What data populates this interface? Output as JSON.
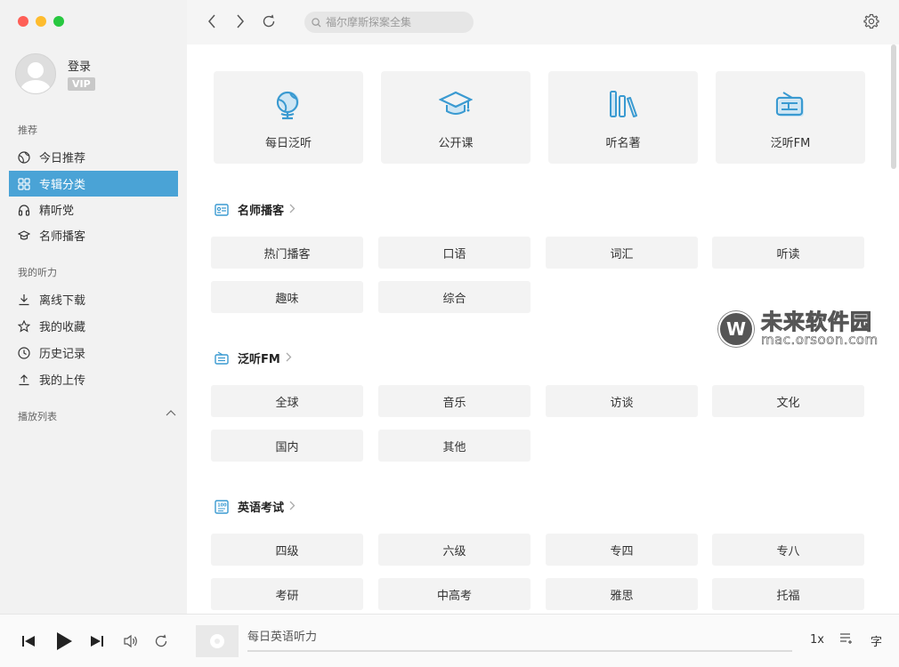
{
  "sidebar": {
    "user": {
      "login": "登录",
      "vip": "VIP"
    },
    "sections": {
      "recommend": "推荐",
      "my_listening": "我的听力",
      "playlist": "播放列表"
    },
    "recommend_items": [
      {
        "label": "今日推荐",
        "icon": "globe-icon"
      },
      {
        "label": "专辑分类",
        "icon": "grid-icon",
        "active": true
      },
      {
        "label": "精听党",
        "icon": "headphones-icon"
      },
      {
        "label": "名师播客",
        "icon": "graduation-cap-icon"
      }
    ],
    "listening_items": [
      {
        "label": "离线下载",
        "icon": "download-icon"
      },
      {
        "label": "我的收藏",
        "icon": "star-icon"
      },
      {
        "label": "历史记录",
        "icon": "clock-icon"
      },
      {
        "label": "我的上传",
        "icon": "upload-icon"
      }
    ]
  },
  "topbar": {
    "search_placeholder": "福尔摩斯探案全集"
  },
  "features": [
    {
      "label": "每日泛听",
      "icon": "globe-icon"
    },
    {
      "label": "公开课",
      "icon": "graduation-cap-icon"
    },
    {
      "label": "听名著",
      "icon": "books-icon"
    },
    {
      "label": "泛听FM",
      "icon": "radio-icon"
    }
  ],
  "sections": [
    {
      "title": "名师播客",
      "icon": "podcast-icon",
      "tags": [
        "热门播客",
        "口语",
        "词汇",
        "听读",
        "趣味",
        "综合"
      ]
    },
    {
      "title": "泛听FM",
      "icon": "radio-icon",
      "tags": [
        "全球",
        "音乐",
        "访谈",
        "文化",
        "国内",
        "其他"
      ]
    },
    {
      "title": "英语考试",
      "icon": "exam-icon",
      "tags": [
        "四级",
        "六级",
        "专四",
        "专八",
        "考研",
        "中高考",
        "雅思",
        "托福"
      ]
    }
  ],
  "watermark": {
    "cn": "未来软件园",
    "url": "mac.orsoon.com"
  },
  "player": {
    "track_title": "每日英语听力",
    "speed": "1x",
    "subtitle": "字"
  },
  "colors": {
    "accent": "#4aa3d6",
    "sidebar_bg": "#f2f2f2"
  }
}
